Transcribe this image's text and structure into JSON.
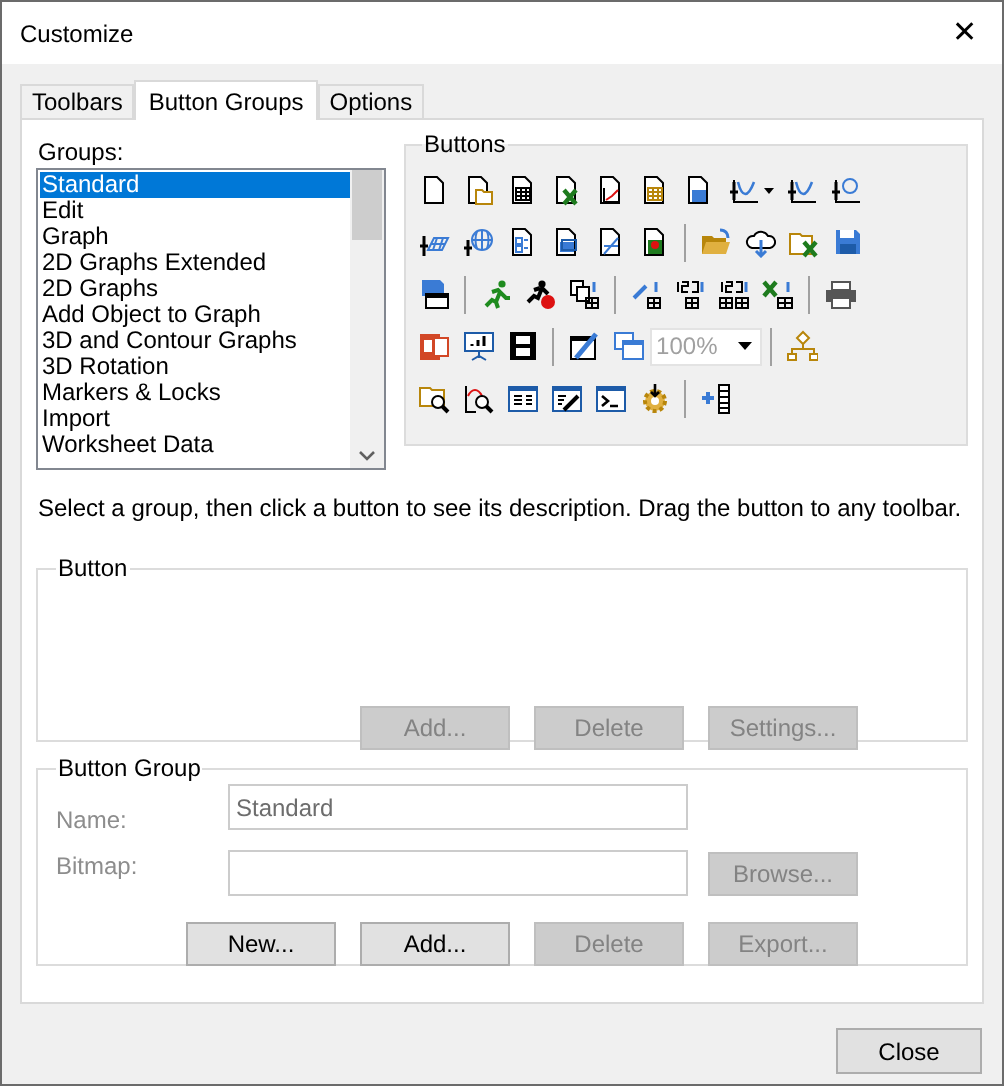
{
  "window": {
    "title": "Customize",
    "close": "✕"
  },
  "tabs": [
    {
      "label": "Toolbars",
      "selected": false
    },
    {
      "label": "Button Groups",
      "selected": true
    },
    {
      "label": "Options",
      "selected": false
    }
  ],
  "groups": {
    "label": "Groups:",
    "items": [
      {
        "label": "Standard",
        "selected": true
      },
      {
        "label": "Edit",
        "selected": false
      },
      {
        "label": "Graph",
        "selected": false
      },
      {
        "label": "2D Graphs Extended",
        "selected": false
      },
      {
        "label": "2D Graphs",
        "selected": false
      },
      {
        "label": "Add Object to Graph",
        "selected": false
      },
      {
        "label": "3D and Contour Graphs",
        "selected": false
      },
      {
        "label": "3D Rotation",
        "selected": false
      },
      {
        "label": "Markers & Locks",
        "selected": false
      },
      {
        "label": "Import",
        "selected": false
      },
      {
        "label": "Worksheet Data",
        "selected": false
      }
    ]
  },
  "buttons_panel": {
    "title": "Buttons",
    "zoom_combo": {
      "value": "100%",
      "disabled": true
    }
  },
  "hint": "Select a group, then click a button to see its description. Drag the button to any toolbar.",
  "button_box": {
    "title": "Button",
    "buttons": [
      {
        "label": "Add...",
        "disabled": true
      },
      {
        "label": "Delete",
        "disabled": true
      },
      {
        "label": "Settings...",
        "disabled": true
      }
    ]
  },
  "button_group_box": {
    "title": "Button Group",
    "name": {
      "label": "Name:",
      "value": "Standard",
      "disabled": true
    },
    "bitmap": {
      "label": "Bitmap:",
      "disabled": true
    },
    "browse": {
      "label": "Browse...",
      "disabled": true
    },
    "buttons": [
      {
        "label": "New...",
        "disabled": false
      },
      {
        "label": "Add...",
        "disabled": false
      },
      {
        "label": "Delete",
        "disabled": true
      },
      {
        "label": "Export...",
        "disabled": true
      }
    ]
  },
  "footer": {
    "close": {
      "label": "Close",
      "disabled": false
    }
  }
}
